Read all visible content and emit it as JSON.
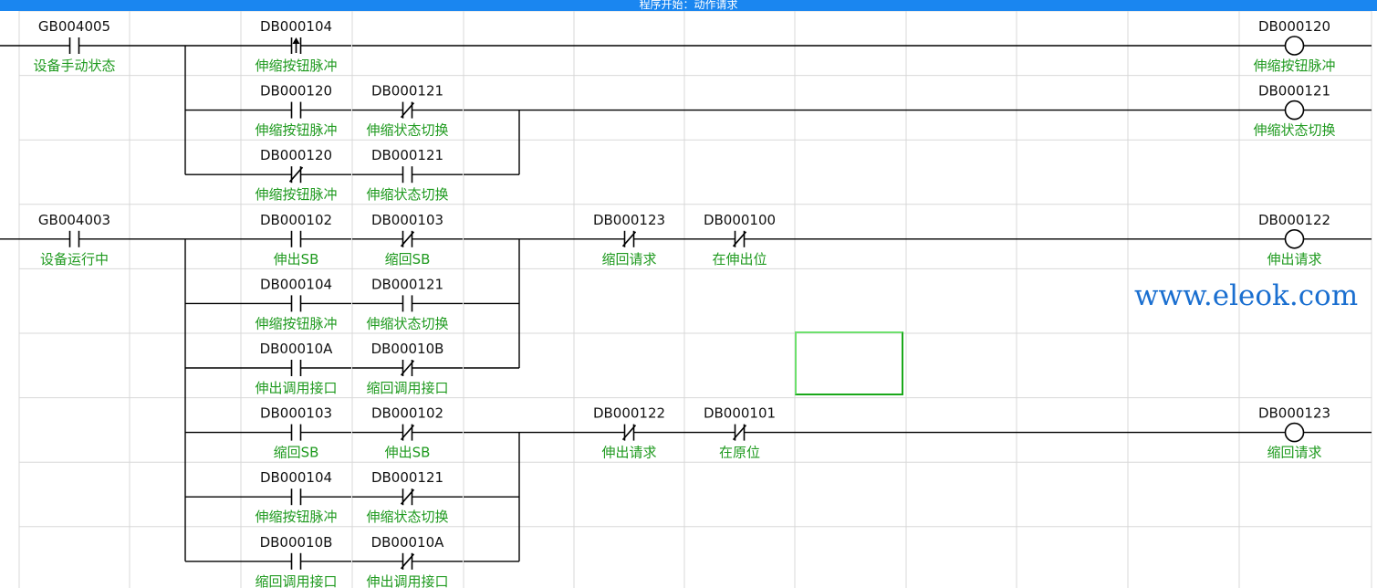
{
  "header": {
    "title": "程序开始：动作请求"
  },
  "watermark": "www.eleok.com",
  "colors": {
    "header_bg": "#1a86f0",
    "comment": "#1f9a1f",
    "wire": "#000000",
    "grid": "#d8d8d8",
    "selection": "#3fcf3f"
  },
  "grid": {
    "columns": 12,
    "rows": 9
  },
  "rungs": [
    {
      "rows": [
        0,
        2
      ],
      "series": [
        {
          "type": "NO",
          "address": "GB004005",
          "comment": "设备手动状态"
        }
      ],
      "branch_groups": [
        {
          "split_col": 2,
          "branches": [
            {
              "row": 0,
              "elements": [
                {
                  "col": 2,
                  "type": "P",
                  "address": "DB000104",
                  "comment": "伸缩按钮脉冲"
                }
              ],
              "coil": {
                "address": "DB000120",
                "comment": "伸缩按钮脉冲"
              }
            },
            {
              "row": 1,
              "elements": [
                {
                  "col": 2,
                  "type": "NO",
                  "address": "DB000120",
                  "comment": "伸缩按钮脉冲"
                },
                {
                  "col": 3,
                  "type": "NC",
                  "address": "DB000121",
                  "comment": "伸缩状态切换"
                }
              ],
              "coil": {
                "address": "DB000121",
                "comment": "伸缩状态切换"
              },
              "merge": 4
            },
            {
              "row": 2,
              "elements": [
                {
                  "col": 2,
                  "type": "NC",
                  "address": "DB000120",
                  "comment": "伸缩按钮脉冲"
                },
                {
                  "col": 3,
                  "type": "NO",
                  "address": "DB000121",
                  "comment": "伸缩状态切换"
                }
              ],
              "merge_to": 1
            }
          ]
        }
      ]
    },
    {
      "rows": [
        3,
        8
      ],
      "series": [
        {
          "type": "NO",
          "address": "GB004003",
          "comment": "设备运行中"
        }
      ],
      "outputs": [
        {
          "row": 3,
          "after_merge": [
            {
              "col": 5,
              "type": "NC",
              "address": "DB000123",
              "comment": "缩回请求"
            },
            {
              "col": 6,
              "type": "NC",
              "address": "DB000100",
              "comment": "在伸出位"
            }
          ],
          "coil": {
            "address": "DB000122",
            "comment": "伸出请求"
          },
          "branches": [
            {
              "row": 3,
              "elements": [
                {
                  "col": 2,
                  "type": "NO",
                  "address": "DB000102",
                  "comment": "伸出SB"
                },
                {
                  "col": 3,
                  "type": "NC",
                  "address": "DB000103",
                  "comment": "缩回SB"
                }
              ]
            },
            {
              "row": 4,
              "elements": [
                {
                  "col": 2,
                  "type": "NO",
                  "address": "DB000104",
                  "comment": "伸缩按钮脉冲"
                },
                {
                  "col": 3,
                  "type": "NO",
                  "address": "DB000121",
                  "comment": "伸缩状态切换"
                }
              ]
            },
            {
              "row": 5,
              "elements": [
                {
                  "col": 2,
                  "type": "NO",
                  "address": "DB00010A",
                  "comment": "伸出调用接口"
                },
                {
                  "col": 3,
                  "type": "NC",
                  "address": "DB00010B",
                  "comment": "缩回调用接口"
                }
              ]
            }
          ]
        },
        {
          "row": 6,
          "after_merge": [
            {
              "col": 5,
              "type": "NC",
              "address": "DB000122",
              "comment": "伸出请求"
            },
            {
              "col": 6,
              "type": "NC",
              "address": "DB000101",
              "comment": "在原位"
            }
          ],
          "coil": {
            "address": "DB000123",
            "comment": "缩回请求"
          },
          "branches": [
            {
              "row": 6,
              "elements": [
                {
                  "col": 2,
                  "type": "NO",
                  "address": "DB000103",
                  "comment": "缩回SB"
                },
                {
                  "col": 3,
                  "type": "NC",
                  "address": "DB000102",
                  "comment": "伸出SB"
                }
              ]
            },
            {
              "row": 7,
              "elements": [
                {
                  "col": 2,
                  "type": "NO",
                  "address": "DB000104",
                  "comment": "伸缩按钮脉冲"
                },
                {
                  "col": 3,
                  "type": "NC",
                  "address": "DB000121",
                  "comment": "伸缩状态切换"
                }
              ]
            },
            {
              "row": 8,
              "elements": [
                {
                  "col": 2,
                  "type": "NO",
                  "address": "DB00010B",
                  "comment": "缩回调用接口"
                },
                {
                  "col": 3,
                  "type": "NC",
                  "address": "DB00010A",
                  "comment": "伸出调用接口"
                }
              ]
            }
          ]
        }
      ]
    }
  ]
}
